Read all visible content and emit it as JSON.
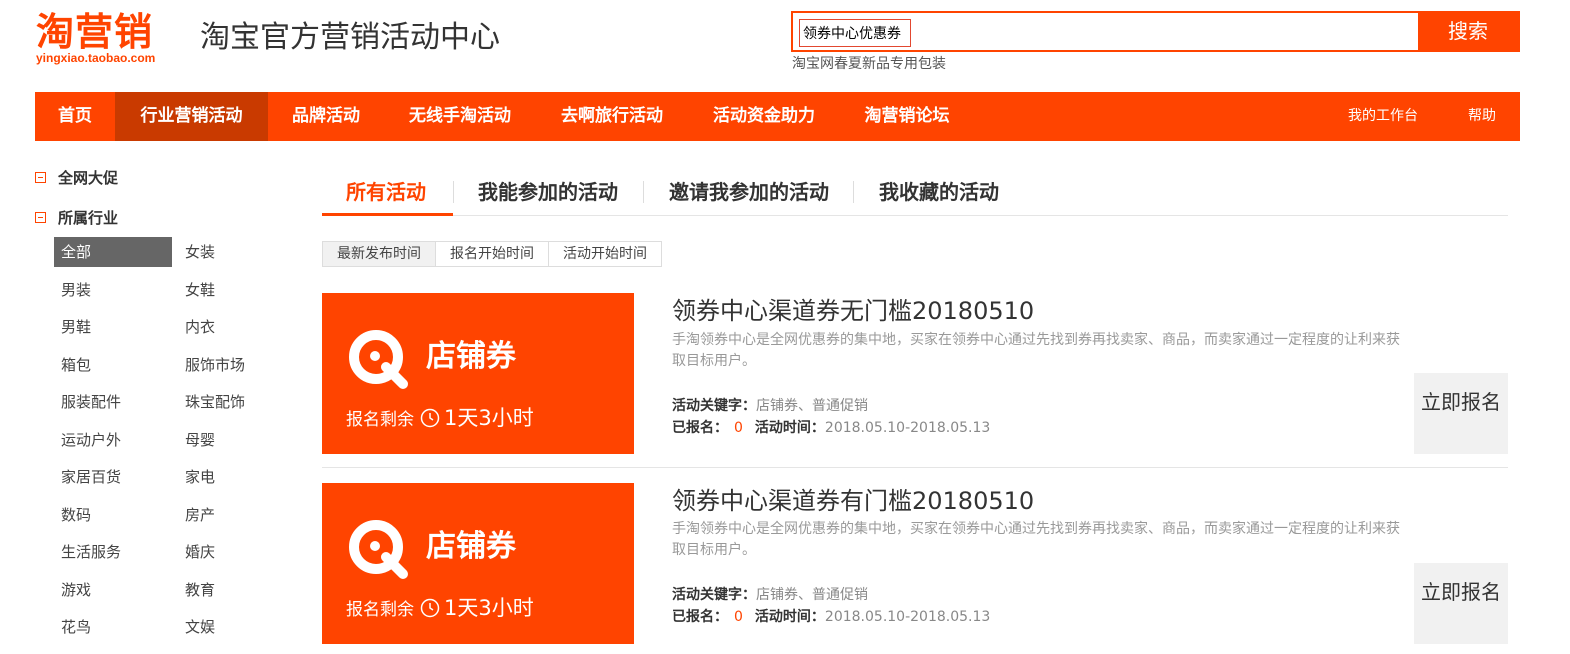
{
  "header": {
    "logo_text": "淘营销",
    "logo_domain": "yingxiao.taobao.com",
    "site_title": "淘宝官方营销活动中心",
    "search_value": "领券中心优惠券",
    "search_button": "搜索",
    "search_hint": "淘宝网春夏新品专用包装"
  },
  "nav": {
    "items": [
      "首页",
      "行业营销活动",
      "品牌活动",
      "无线手淘活动",
      "去啊旅行活动",
      "活动资金助力",
      "淘营销论坛"
    ],
    "active_index": 1,
    "right": [
      "我的工作台",
      "帮助"
    ]
  },
  "sidebar": {
    "group1": "全网大促",
    "group2": "所属行业",
    "categories": [
      "全部",
      "女装",
      "男装",
      "女鞋",
      "男鞋",
      "内衣",
      "箱包",
      "服饰市场",
      "服装配件",
      "珠宝配饰",
      "运动户外",
      "母婴",
      "家居百货",
      "家电",
      "数码",
      "房产",
      "生活服务",
      "婚庆",
      "游戏",
      "教育",
      "花鸟",
      "文娱"
    ],
    "active_index": 0
  },
  "tabs": {
    "items": [
      "所有活动",
      "我能参加的活动",
      "邀请我参加的活动",
      "我收藏的活动"
    ],
    "active_index": 0
  },
  "sort": {
    "items": [
      "最新发布时间",
      "报名开始时间",
      "活动开始时间"
    ],
    "active_index": 0
  },
  "activities": [
    {
      "banner_title": "店铺券",
      "remain_label": "报名剩余",
      "remain_time": "1天3小时",
      "title": "领券中心渠道券无门槛20180510",
      "desc": "手淘领券中心是全网优惠券的集中地，买家在领券中心通过先找到券再找卖家、商品，而卖家通过一定程度的让利来获取目标用户。",
      "keyword_label": "活动关键字：",
      "keywords": "店铺券、普通促销",
      "signed_label": "已报名：",
      "signed_count": "0",
      "time_label": "活动时间：",
      "time_range": "2018.05.10-2018.05.13",
      "join_button": "立即报名"
    },
    {
      "banner_title": "店铺券",
      "remain_label": "报名剩余",
      "remain_time": "1天3小时",
      "title": "领券中心渠道券有门槛20180510",
      "desc": "手淘领券中心是全网优惠券的集中地，买家在领券中心通过先找到券再找卖家、商品，而卖家通过一定程度的让利来获取目标用户。",
      "keyword_label": "活动关键字：",
      "keywords": "店铺券、普通促销",
      "signed_label": "已报名：",
      "signed_count": "0",
      "time_label": "活动时间：",
      "time_range": "2018.05.10-2018.05.13",
      "join_button": "立即报名"
    }
  ],
  "colors": {
    "brand": "#ff4400",
    "nav_active": "#c93a00",
    "sidebar_active": "#666666"
  }
}
